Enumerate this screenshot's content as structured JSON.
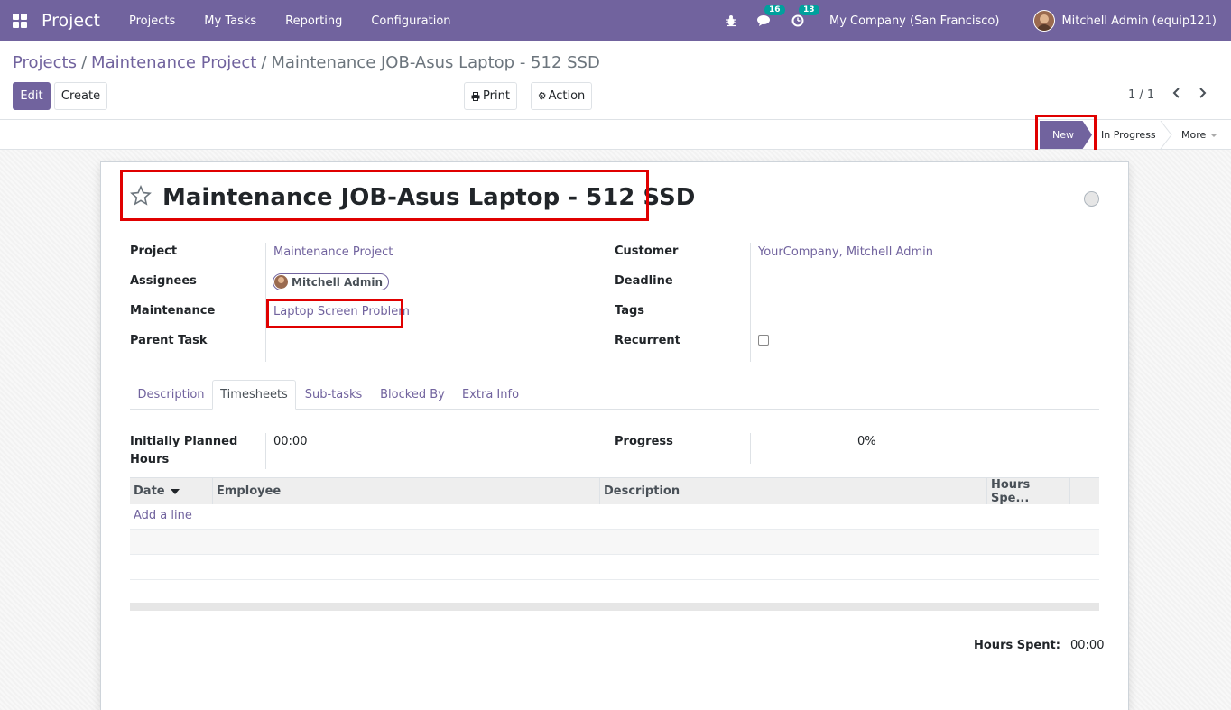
{
  "navbar": {
    "app_name": "Project",
    "menu": [
      "Projects",
      "My Tasks",
      "Reporting",
      "Configuration"
    ],
    "messages_count": "16",
    "activities_count": "13",
    "company": "My Company (San Francisco)",
    "user": "Mitchell Admin (equip121)",
    "icons": [
      "apps-icon",
      "bug-icon",
      "chat-icon",
      "clock-icon"
    ]
  },
  "breadcrumb": {
    "items": [
      "Projects",
      "Maintenance Project"
    ],
    "separator": "/",
    "current": "Maintenance JOB-Asus Laptop - 512 SSD"
  },
  "toolbar": {
    "edit_label": "Edit",
    "create_label": "Create",
    "print_label": "Print",
    "action_label": "Action",
    "pager": "1 / 1"
  },
  "status": {
    "stages": [
      "New",
      "In Progress"
    ],
    "more_label": "More",
    "active_stage": "New"
  },
  "form": {
    "title": "Maintenance JOB-Asus Laptop - 512 SSD",
    "fields_left": [
      {
        "label": "Project",
        "value": "Maintenance Project"
      },
      {
        "label": "Assignees",
        "value": "Mitchell Admin"
      },
      {
        "label": "Maintenance",
        "value": "Laptop Screen Problem"
      },
      {
        "label": "Parent Task",
        "value": ""
      }
    ],
    "fields_right": [
      {
        "label": "Customer",
        "value": "YourCompany, Mitchell Admin"
      },
      {
        "label": "Deadline",
        "value": ""
      },
      {
        "label": "Tags",
        "value": ""
      },
      {
        "label": "Recurrent",
        "value": ""
      }
    ],
    "recurrent_checked": false
  },
  "tabs": [
    "Description",
    "Timesheets",
    "Sub-tasks",
    "Blocked By",
    "Extra Info"
  ],
  "active_tab": "Timesheets",
  "timesheets": {
    "planned_label_1": "Initially Planned",
    "planned_label_2": "Hours",
    "planned_value": "00:00",
    "progress_label": "Progress",
    "progress_value": "0%",
    "columns": [
      "Date",
      "Employee",
      "Description",
      "Hours Spe..."
    ],
    "add_line": "Add a line",
    "hours_spent_label": "Hours Spent:",
    "hours_spent_value": "00:00"
  },
  "colors": {
    "brand": "#71639e",
    "badge": "#00a09d",
    "highlight": "#e00000"
  }
}
